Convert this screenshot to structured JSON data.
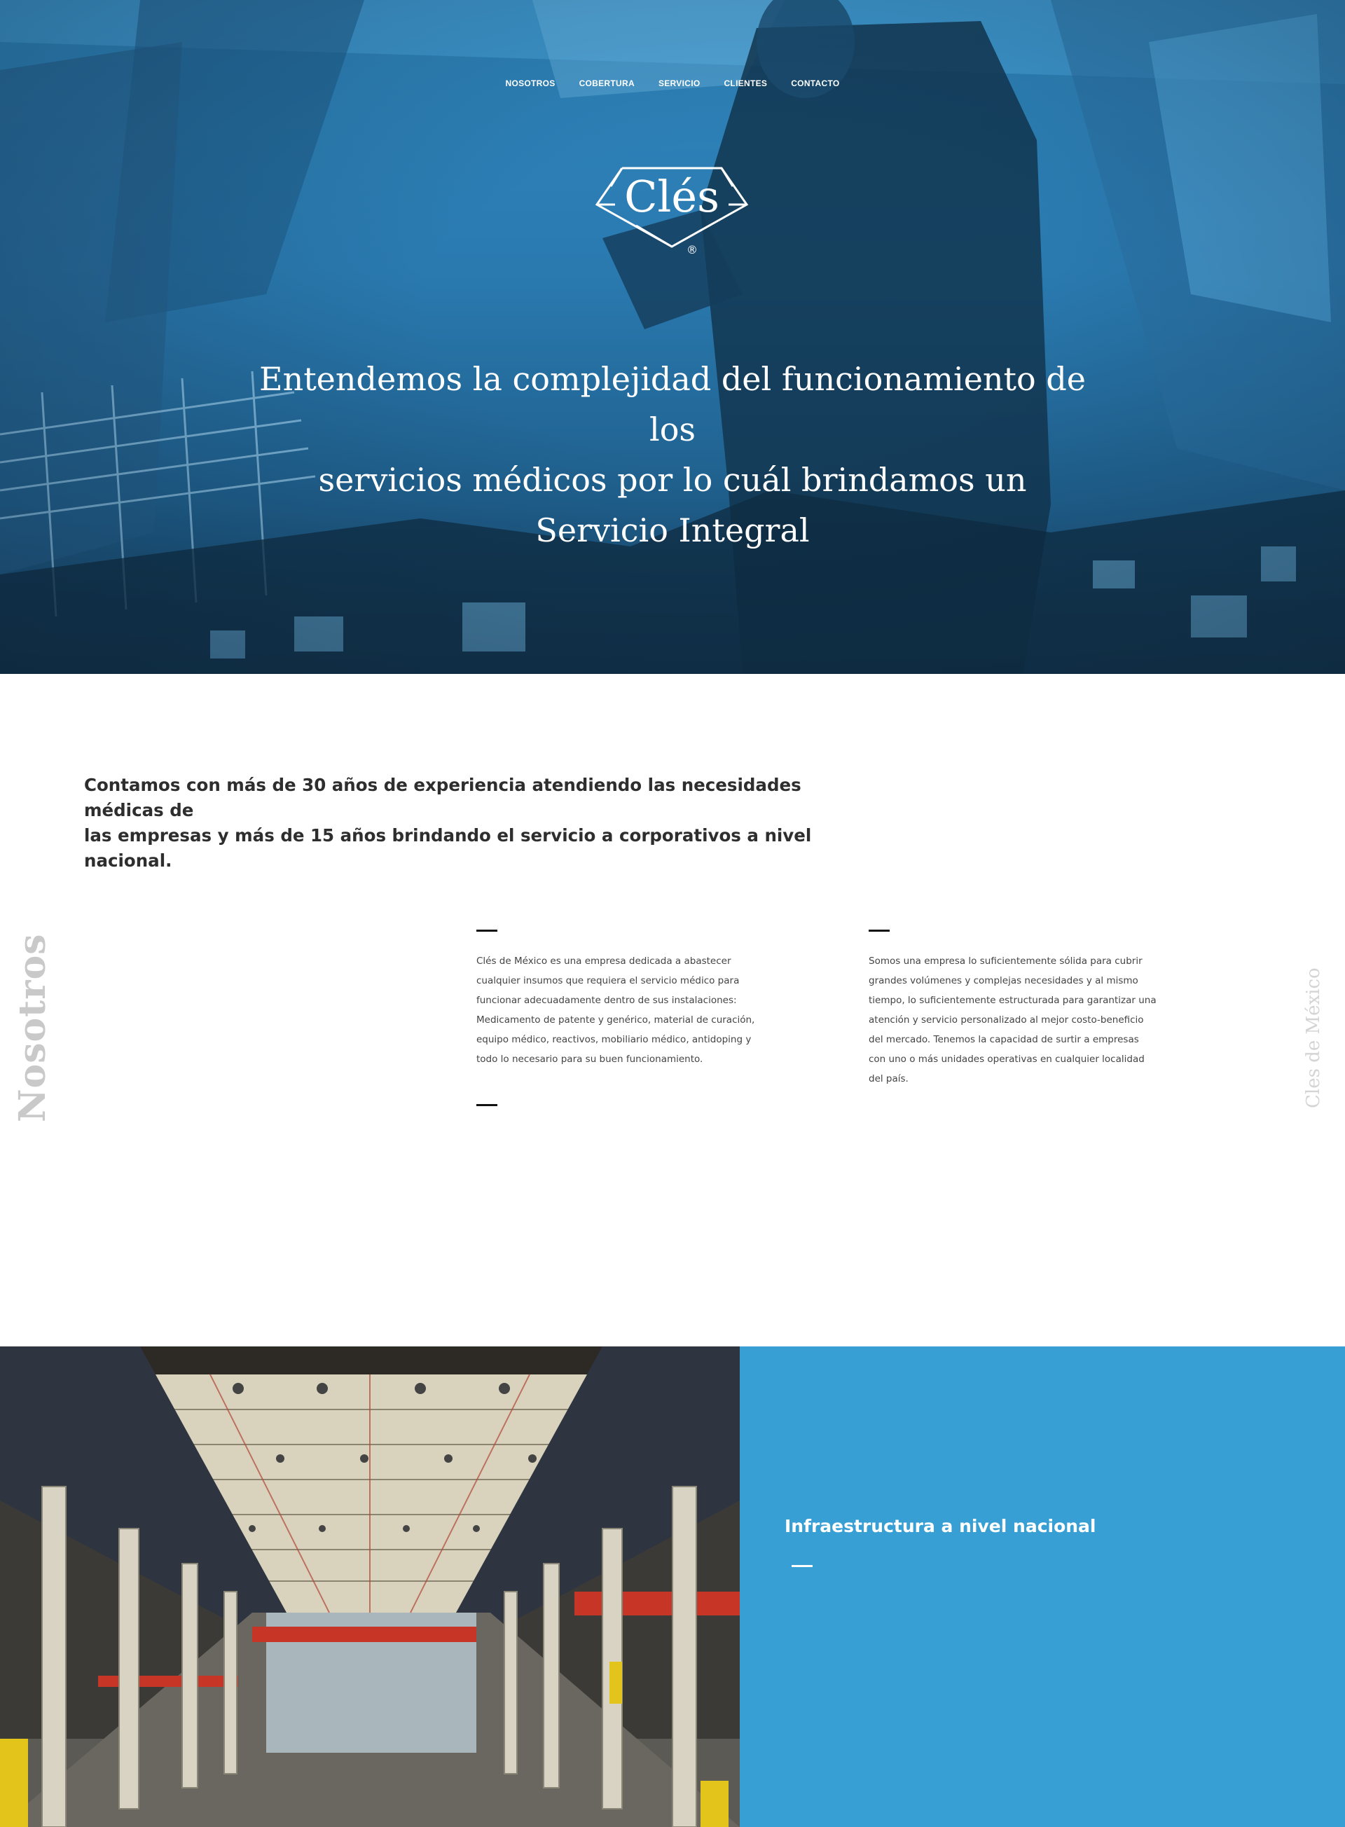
{
  "nav": {
    "items": [
      "NOSOTROS",
      "COBERTURA",
      "SERVICIO",
      "CLIENTES",
      "CONTACTO"
    ]
  },
  "logo": {
    "text": "Clés",
    "mark": "®"
  },
  "hero": {
    "lines": [
      "Entendemos la complejidad del funcionamiento de los",
      "servicios médicos por lo cuál brindamos un",
      "Servicio Integral"
    ]
  },
  "about": {
    "lead": [
      "Contamos con más de 30 años de experiencia atendiendo las necesidades médicas de",
      "las empresas y más de 15 años brindando el servicio a corporativos a nivel nacional."
    ],
    "side_left": "Nosotros",
    "side_right": "Cles de México",
    "col1": [
      "Clés de México es una empresa dedicada a abastecer",
      "cualquier insumos que requiera el servicio médico para",
      "funcionar adecuadamente dentro de sus instalaciones:",
      "Medicamento de patente y genérico, material de curación,",
      "equipo médico, reactivos, mobiliario médico, antidoping y",
      "todo lo necesario para su buen funcionamiento."
    ],
    "col2": [
      "Somos una empresa lo suficientemente sólida para cubrir",
      "grandes volúmenes y complejas necesidades y al mismo",
      "tiempo, lo suficientemente estructurada para garantizar una",
      "atención y servicio personalizado al mejor costo-beneficio",
      "del mercado. Tenemos la capacidad de surtir a empresas",
      "con uno o más unidades operativas en cualquier localidad",
      "del país."
    ]
  },
  "infra": {
    "title": "Infraestructura a nivel nacional"
  },
  "colors": {
    "accent": "#389fd4",
    "hero_tint": "#2a7ab0",
    "text": "#2e2e2e"
  }
}
